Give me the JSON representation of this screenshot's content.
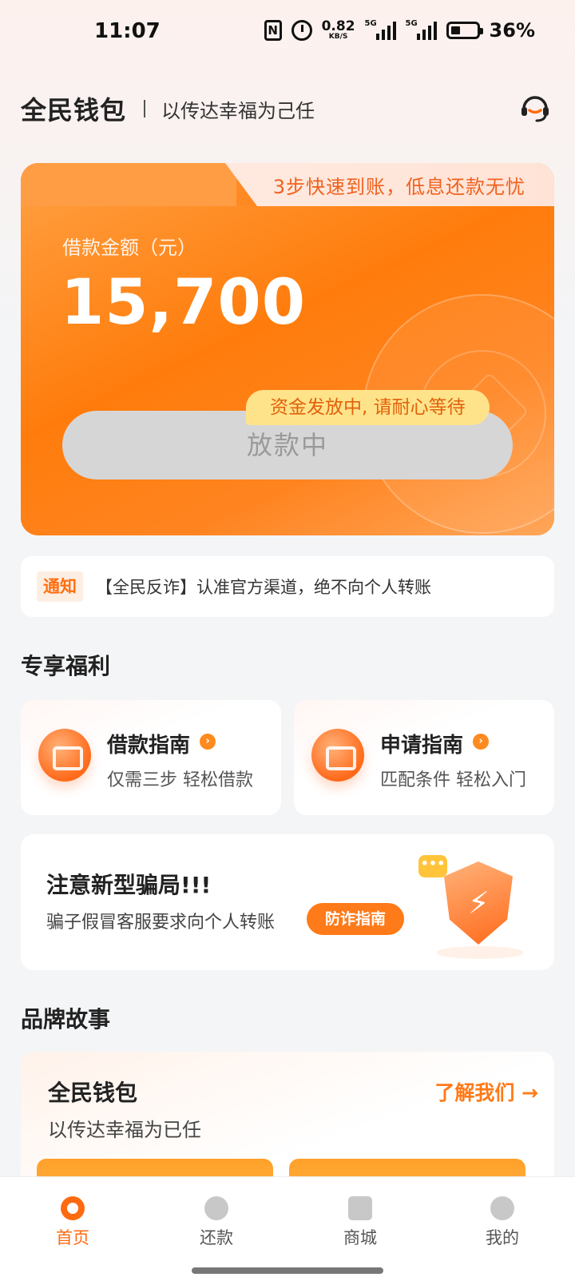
{
  "status_bar": {
    "time": "11:07",
    "nfc": "N",
    "net_speed": "0.82",
    "net_unit": "KB/S",
    "signal1": "5G",
    "signal2": "5G",
    "battery": "36%"
  },
  "header": {
    "brand": "全民钱包",
    "slogan": "以传达幸福为己任"
  },
  "loan_card": {
    "banner": "3步快速到账，低息还款无忧",
    "amount_label": "借款金额（元）",
    "amount": "15,700",
    "status_tag": "资金发放中, 请耐心等待",
    "button_label": "放款中"
  },
  "notice": {
    "tag": "通知",
    "text": "【全民反诈】认准官方渠道，绝不向个人转账"
  },
  "benefits": {
    "title": "专享福利",
    "cards": [
      {
        "title": "借款指南",
        "subtitle": "仅需三步 轻松借款"
      },
      {
        "title": "申请指南",
        "subtitle": "匹配条件 轻松入门"
      }
    ]
  },
  "scam_alert": {
    "title": "注意新型骗局!!!",
    "subtitle": "骗子假冒客服要求向个人转账",
    "button_label": "防诈指南",
    "bubble": "•••"
  },
  "brand_story": {
    "section_title": "品牌故事",
    "title": "全民钱包",
    "subtitle": "以传达幸福为已任",
    "link": "了解我们 →"
  },
  "tabbar": {
    "items": [
      {
        "label": "首页",
        "icon": "home-icon",
        "active": true
      },
      {
        "label": "还款",
        "icon": "repay-icon",
        "active": false
      },
      {
        "label": "商城",
        "icon": "shop-icon",
        "active": false
      },
      {
        "label": "我的",
        "icon": "profile-icon",
        "active": false
      }
    ]
  },
  "colors": {
    "accent": "#ff7a18",
    "card_orange": "#ff7c0c",
    "disabled_button": "#d6d6d6",
    "wait_tag": "#ffe38a"
  }
}
